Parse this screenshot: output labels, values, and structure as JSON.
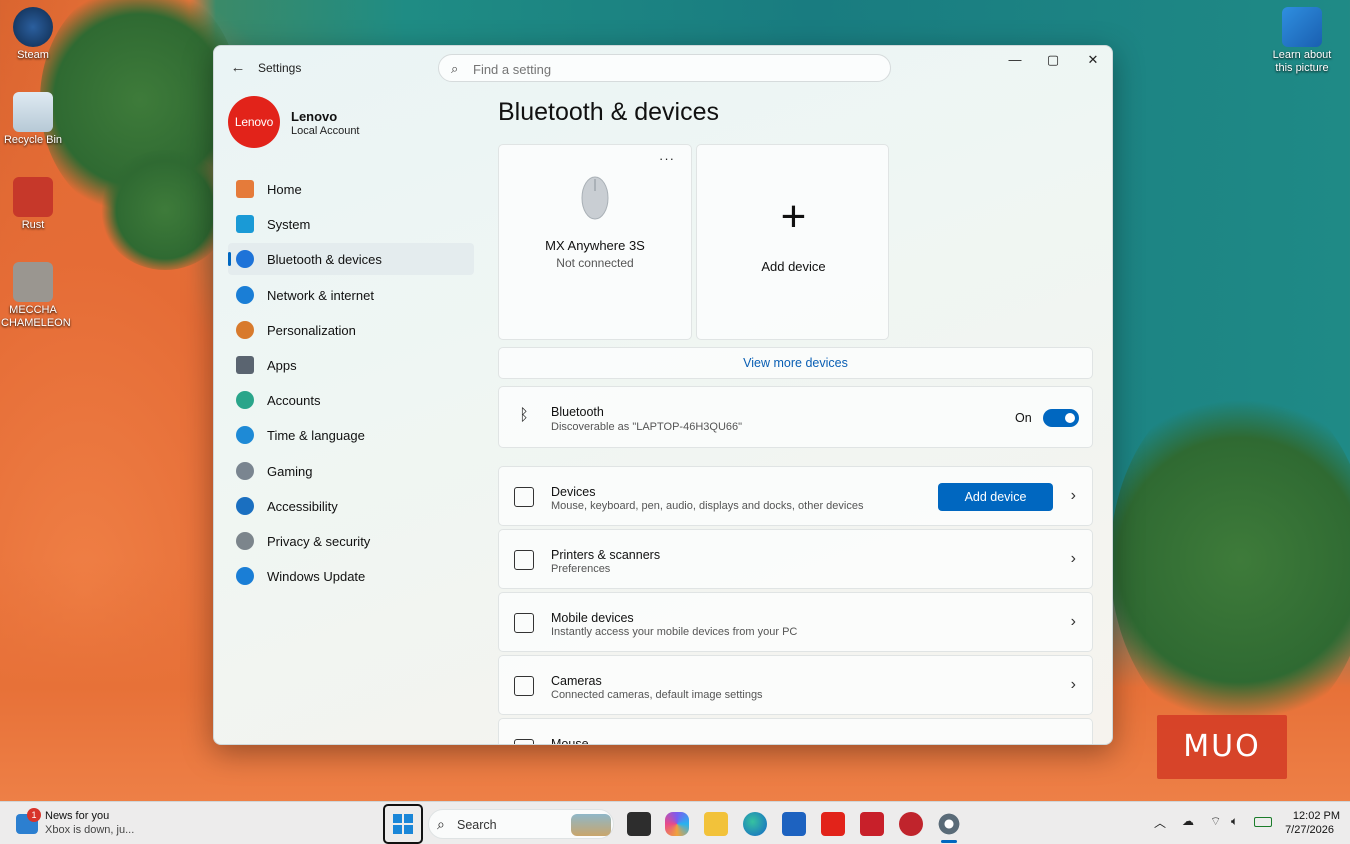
{
  "desktop": {
    "icons": [
      {
        "label": "Steam"
      },
      {
        "label": "Recycle Bin"
      },
      {
        "label": "Rust"
      },
      {
        "label": "MECCHA CHAMELEON"
      }
    ],
    "learn": "Learn about this picture"
  },
  "window": {
    "app_title": "Settings",
    "search_placeholder": "Find a setting",
    "controls": {
      "minimize": "—",
      "maximize": "▢",
      "close": "✕"
    }
  },
  "profile": {
    "avatar_text": "Lenovo",
    "name": "Lenovo",
    "account": "Local Account"
  },
  "nav": [
    {
      "label": "Home",
      "icon": "home-icon",
      "color": "#e57b3a"
    },
    {
      "label": "System",
      "icon": "system-icon",
      "color": "#1a9ad6"
    },
    {
      "label": "Bluetooth & devices",
      "icon": "bluetooth-icon",
      "color": "#1e73d8",
      "selected": true
    },
    {
      "label": "Network & internet",
      "icon": "wifi-icon",
      "color": "#1a7ed6"
    },
    {
      "label": "Personalization",
      "icon": "brush-icon",
      "color": "#d87a2c"
    },
    {
      "label": "Apps",
      "icon": "apps-icon",
      "color": "#5a6470"
    },
    {
      "label": "Accounts",
      "icon": "person-icon",
      "color": "#2aa58a"
    },
    {
      "label": "Time & language",
      "icon": "globe-clock-icon",
      "color": "#1e8ad6"
    },
    {
      "label": "Gaming",
      "icon": "gamepad-icon",
      "color": "#7a8590"
    },
    {
      "label": "Accessibility",
      "icon": "accessibility-icon",
      "color": "#1a6fc0"
    },
    {
      "label": "Privacy & security",
      "icon": "shield-icon",
      "color": "#7c858c"
    },
    {
      "label": "Windows Update",
      "icon": "update-icon",
      "color": "#1a7ed6"
    }
  ],
  "main": {
    "title": "Bluetooth & devices",
    "device": {
      "name": "MX Anywhere 3S",
      "status": "Not connected",
      "more": "···"
    },
    "add_card": {
      "plus": "+",
      "label": "Add device"
    },
    "view_more": "View more devices",
    "bluetooth": {
      "title": "Bluetooth",
      "subtitle": "Discoverable as \"LAPTOP-46H3QU66\"",
      "state": "On",
      "enabled": true
    },
    "rows": [
      {
        "title": "Devices",
        "subtitle": "Mouse, keyboard, pen, audio, displays and docks, other devices",
        "button": "Add device",
        "icon": "keyboard-icon"
      },
      {
        "title": "Printers & scanners",
        "subtitle": "Preferences",
        "icon": "printer-icon"
      },
      {
        "title": "Mobile devices",
        "subtitle": "Instantly access your mobile devices from your PC",
        "icon": "phone-icon"
      },
      {
        "title": "Cameras",
        "subtitle": "Connected cameras, default image settings",
        "icon": "camera-icon"
      },
      {
        "title": "Mouse",
        "subtitle": "",
        "icon": "mouse-icon"
      }
    ]
  },
  "taskbar": {
    "news_title": "News for you",
    "news_sub": "Xbox is down, ju...",
    "news_badge": "1",
    "search": "Search",
    "time": "12:02 PM",
    "date": "7/27/2026"
  },
  "watermark": "MUO"
}
